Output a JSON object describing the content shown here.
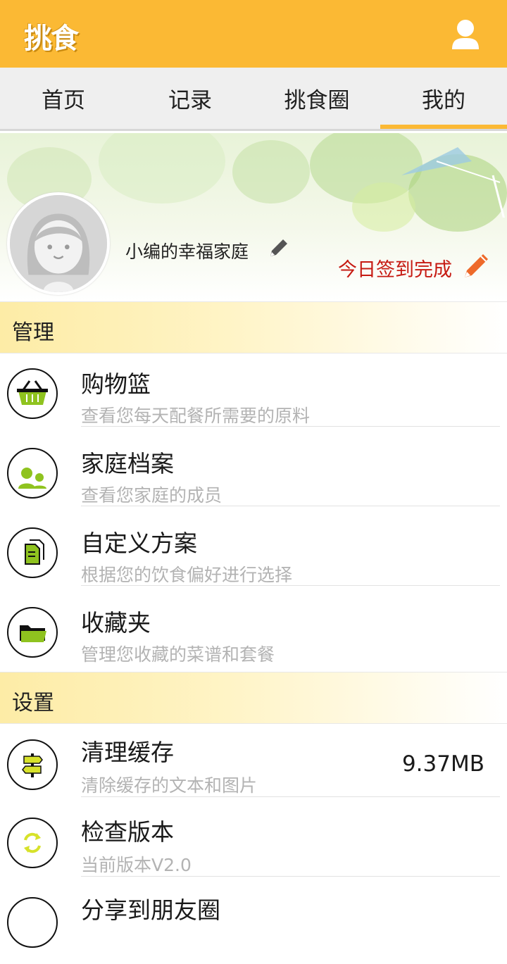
{
  "app": {
    "logo": "挑食"
  },
  "header": {
    "user_icon": "user-icon"
  },
  "tabs": [
    {
      "label": "首页"
    },
    {
      "label": "记录"
    },
    {
      "label": "挑食圈"
    },
    {
      "label": "我的",
      "active": true
    }
  ],
  "profile": {
    "family_name": "小编的幸福家庭",
    "signin_text": "今日签到完成"
  },
  "sections": {
    "manage": "管理",
    "settings": "设置"
  },
  "manage_items": [
    {
      "title": "购物篮",
      "subtitle": "查看您每天配餐所需要的原料",
      "icon": "basket-icon"
    },
    {
      "title": "家庭档案",
      "subtitle": "查看您家庭的成员",
      "icon": "family-icon"
    },
    {
      "title": "自定义方案",
      "subtitle": "根据您的饮食偏好进行选择",
      "icon": "document-icon"
    },
    {
      "title": "收藏夹",
      "subtitle": "管理您收藏的菜谱和套餐",
      "icon": "folder-icon"
    }
  ],
  "settings_items": [
    {
      "title": "清理缓存",
      "subtitle": "清除缓存的文本和图片",
      "value": "9.37MB",
      "icon": "signpost-icon"
    },
    {
      "title": "检查版本",
      "subtitle": "当前版本V2.0",
      "icon": "refresh-icon"
    },
    {
      "title": "分享到朋友圈",
      "icon": "share-icon"
    }
  ],
  "colors": {
    "accent": "#fbb934",
    "icon_green": "#8fc31f",
    "signin_red": "#c61a12"
  }
}
